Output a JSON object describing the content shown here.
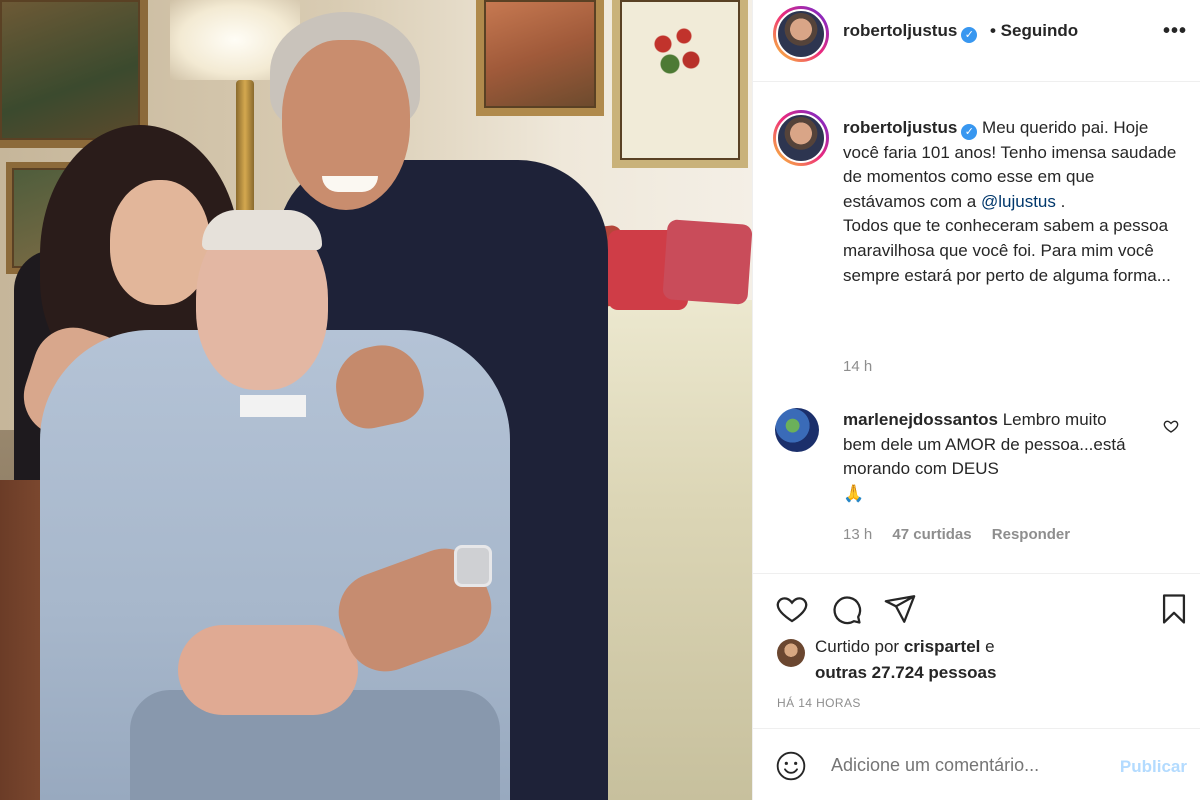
{
  "header": {
    "username": "robertoljustus",
    "verified_icon": "verified-badge-icon",
    "follow_status": "• Seguindo",
    "more_icon": "more-options-icon",
    "more_glyph": "•••"
  },
  "caption": {
    "username": "robertoljustus",
    "text_part1": "Meu querido pai. Hoje você faria 101 anos! Tenho imensa saudade de momentos como esse em que estávamos com a",
    "mention": "@lujustus",
    "text_part2": " .",
    "text_part3": "Todos que te conheceram sabem a pessoa maravilhosa que você foi. Para mim você sempre estará por perto de alguma forma...",
    "time": "14 h"
  },
  "comment": {
    "username": "marlenejdossantos",
    "text": "Lembro muito bem dele um AMOR de pessoa...está morando com DEUS",
    "emoji": "🙏",
    "time": "13 h",
    "likes": "47 curtidas",
    "reply": "Responder"
  },
  "actions": {
    "like_icon": "heart-icon",
    "comment_icon": "comment-icon",
    "share_icon": "share-icon",
    "save_icon": "bookmark-icon"
  },
  "liked_by": {
    "prefix": "Curtido por ",
    "user": "crispartel",
    "conj": " e",
    "others": "outras 27.724 pessoas"
  },
  "posted": "HÁ 14 HORAS",
  "add_comment": {
    "placeholder": "Adicione um comentário...",
    "publish": "Publicar",
    "emoji_icon": "emoji-smile-icon"
  },
  "colors": {
    "link": "#00376b",
    "verified": "#3897f0",
    "publish_disabled": "#b3dbff",
    "muted": "#8e8e8e"
  }
}
